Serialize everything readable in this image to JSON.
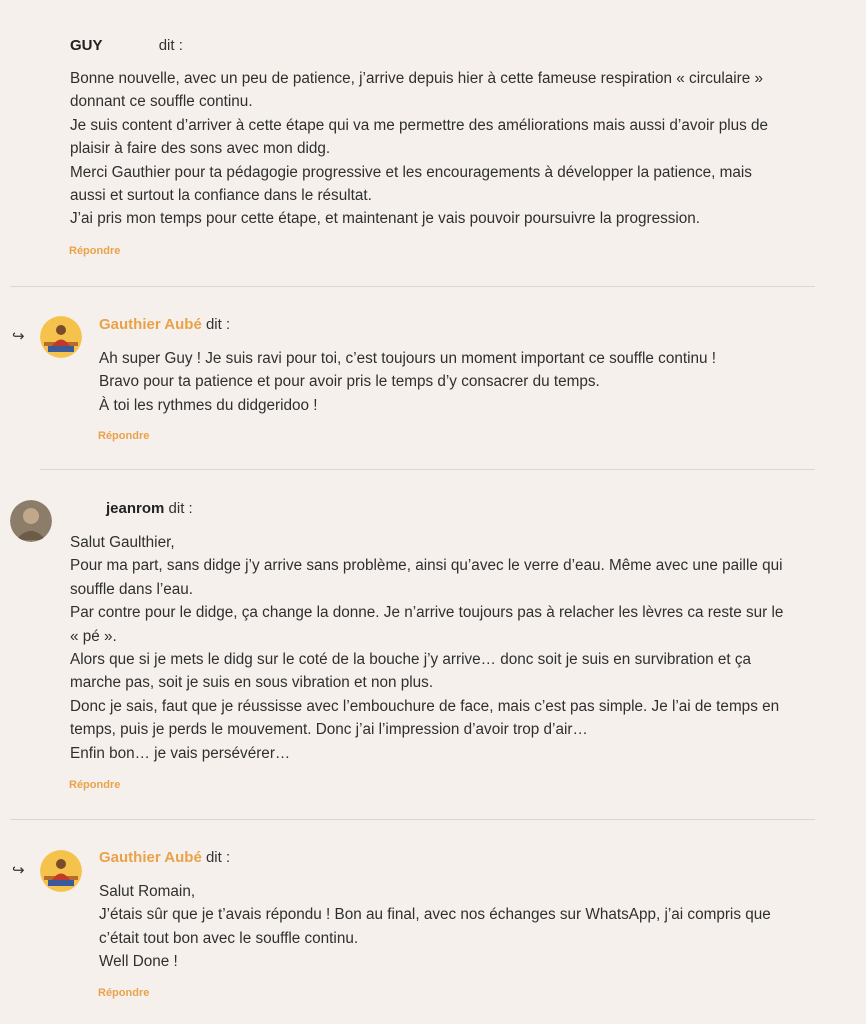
{
  "comments": [
    {
      "author": "GUY",
      "says": "dit :",
      "lines": [
        "Bonne nouvelle, avec un peu de patience, j’arrive depuis hier à cette fameuse respiration « circulaire »",
        "donnant ce souffle continu.",
        "Je suis content d’arriver à cette étape qui va me permettre des améliorations mais aussi d’avoir plus de",
        "plaisir à faire des sons avec mon didg.",
        "Merci Gauthier pour ta pédagogie progressive et les encouragements à développer la patience, mais",
        "aussi et surtout la confiance dans le résultat.",
        "J’ai pris mon temps pour cette étape, et maintenant je vais pouvoir poursuivre la progression."
      ],
      "reply": "Répondre"
    },
    {
      "author": "Gauthier Aubé",
      "says": "dit :",
      "reply_arrow": "↪",
      "lines": [
        "Ah super Guy ! Je suis ravi pour toi, c’est toujours un moment important ce souffle continu !",
        "Bravo pour ta patience et pour avoir pris le temps d’y consacrer du temps.",
        "À toi les rythmes du didgeridoo !"
      ],
      "reply": "Répondre"
    },
    {
      "author": "jeanrom",
      "says": "dit :",
      "lines": [
        "Salut Gaulthier,",
        "Pour ma part, sans didge j’y arrive sans problème, ainsi qu’avec le verre d’eau. Même avec une paille qui",
        "souffle dans l’eau.",
        "Par contre pour le didge, ça change la donne. Je n’arrive toujours pas à relacher les lèvres ca reste sur le",
        "« pé ».",
        "Alors que si je mets le didg sur le coté de la bouche j’y arrive… donc soit je suis en survibration et ça",
        "marche pas, soit je suis en sous vibration et non plus.",
        "Donc je sais, faut que je réussisse avec l’embouchure de face, mais c’est pas simple. Je l’ai de temps en",
        "temps, puis je perds le mouvement. Donc j’ai l’impression d’avoir trop d’air…",
        "Enfin bon… je vais persévérer…"
      ],
      "reply": "Répondre"
    },
    {
      "author": "Gauthier Aubé",
      "says": "dit :",
      "reply_arrow": "↪",
      "lines": [
        "Salut Romain,",
        "J’étais sûr que je t’avais répondu ! Bon au final, avec nos échanges sur WhatsApp, j’ai compris que",
        "c’était tout bon avec le souffle continu.",
        "Well Done !"
      ],
      "reply": "Répondre"
    }
  ],
  "colors": {
    "background": "#f6f0ec",
    "accent": "#e9a24a",
    "separator": "#dcd5d0"
  }
}
